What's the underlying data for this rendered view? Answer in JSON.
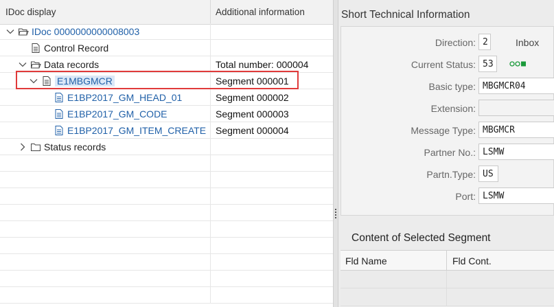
{
  "tree": {
    "headers": {
      "col1": "IDoc display",
      "col2": "Additional information"
    },
    "nodes": [
      {
        "label": "IDoc 0000000000008003",
        "info": "",
        "caret": "down",
        "icon": "folder-open-icon",
        "link": true
      },
      {
        "label": "Control Record",
        "info": "",
        "caret": "none",
        "icon": "document-icon",
        "link": false
      },
      {
        "label": "Data records",
        "info": "Total number: 000004",
        "caret": "down",
        "icon": "folder-open-icon",
        "link": false
      },
      {
        "label": "E1MBGMCR",
        "info": "Segment 000001",
        "caret": "down",
        "icon": "document-icon",
        "link": true,
        "selected": true
      },
      {
        "label": "E1BP2017_GM_HEAD_01",
        "info": "Segment 000002",
        "caret": "none",
        "icon": "document-icon",
        "link": true
      },
      {
        "label": "E1BP2017_GM_CODE",
        "info": "Segment 000003",
        "caret": "none",
        "icon": "document-icon",
        "link": true
      },
      {
        "label": "E1BP2017_GM_ITEM_CREATE",
        "info": "Segment 000004",
        "caret": "none",
        "icon": "document-icon",
        "link": true
      },
      {
        "label": "Status records",
        "info": "",
        "caret": "right",
        "icon": "folder-icon",
        "link": false
      }
    ]
  },
  "short_info": {
    "title": "Short Technical Information",
    "direction_label": "Direction:",
    "direction_value": "2",
    "direction_text": "Inbox",
    "status_label": "Current Status:",
    "status_value": "53",
    "status_icon": "status-ok-icon",
    "basic_type_label": "Basic type:",
    "basic_type_value": "MBGMCR04",
    "extension_label": "Extension:",
    "extension_value": "",
    "message_type_label": "Message Type:",
    "message_type_value": "MBGMCR",
    "partner_no_label": "Partner No.:",
    "partner_no_value": "LSMW",
    "partn_type_label": "Partn.Type:",
    "partn_type_value": "US",
    "port_label": "Port:",
    "port_value": "LSMW"
  },
  "segment": {
    "title": "Content of Selected Segment",
    "col1": "Fld Name",
    "col2": "Fld Cont."
  },
  "colors": {
    "link": "#2060a8",
    "highlight": "#e03a3a",
    "status_green": "#1a9a3a"
  }
}
